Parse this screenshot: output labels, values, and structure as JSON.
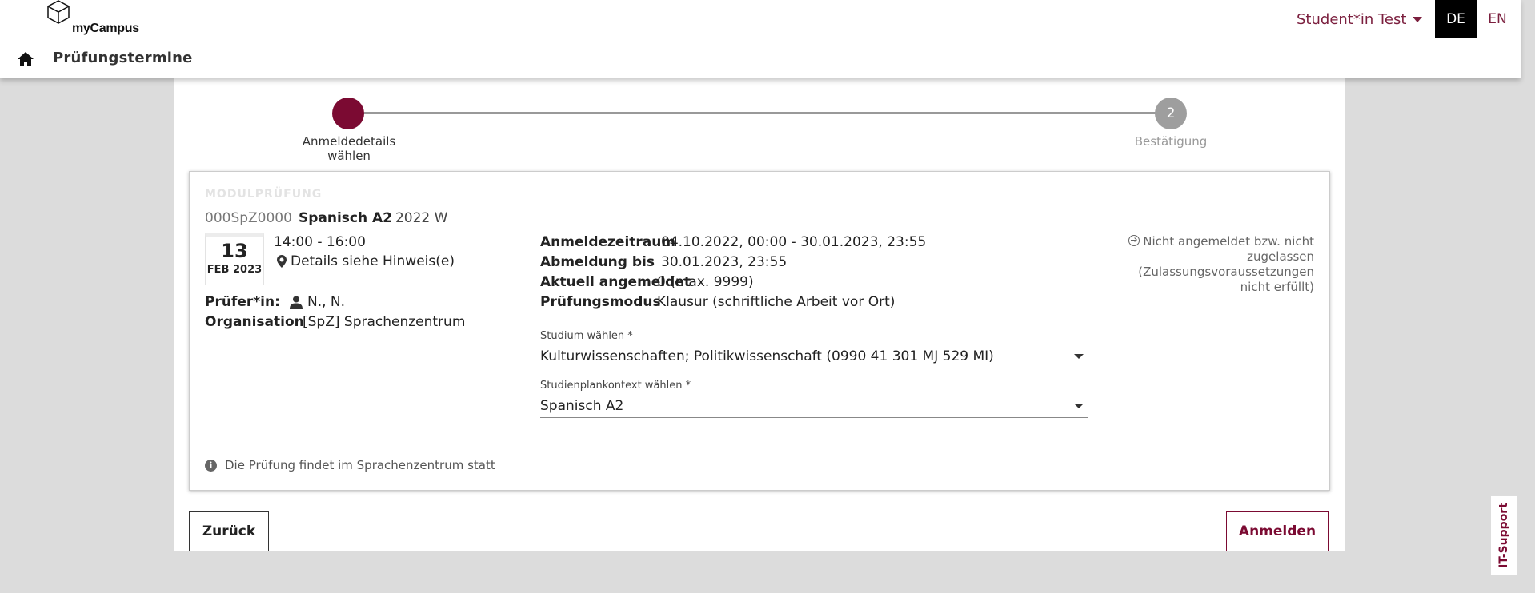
{
  "header": {
    "logo_text": "myCampus",
    "page_title": "Prüfungstermine",
    "user_menu": "Student*in Test",
    "lang_de": "DE",
    "lang_en": "EN"
  },
  "stepper": {
    "step1_label": "Anmeldedetails wählen",
    "step2_number": "2",
    "step2_label": "Bestätigung"
  },
  "exam": {
    "kicker": "MODULPRÜFUNG",
    "code": "000SpZ0000",
    "course": "Spanisch A2",
    "term": "2022 W",
    "date_day": "13",
    "date_month": "FEB 2023",
    "time": "14:00 - 16:00",
    "location": "Details siehe Hinweis(e)",
    "examiner_label": "Prüfer*in:",
    "examiner_value": "N., N.",
    "org_label": "Organisation",
    "org_value": "[SpZ] Sprachenzentrum"
  },
  "details": {
    "registration_period_label": "Anmeldezeitraum",
    "registration_period_value": "04.10.2022, 00:00 - 30.01.2023, 23:55",
    "deregistration_label": "Abmeldung bis",
    "deregistration_value": "30.01.2023, 23:55",
    "registered_label": "Aktuell angemeldet",
    "registered_value": "0 (max. 9999)",
    "mode_label": "Prüfungsmodus",
    "mode_value": "Klausur (schriftliche Arbeit vor Ort)"
  },
  "form": {
    "study_label": "Studium wählen *",
    "study_value": "Kulturwissenschaften; Politikwissenschaft (0990 41 301 MJ 529 MI)",
    "context_label": "Studienplankontext wählen *",
    "context_value": "Spanisch A2"
  },
  "status_text": "Nicht angemeldet bzw. nicht zugelassen (Zulassungsvoraussetzungen nicht erfüllt)",
  "note": "Die Prüfung findet im Sprachenzentrum statt",
  "buttons": {
    "back": "Zurück",
    "register": "Anmelden"
  },
  "it_support": "IT-Support",
  "colors": {
    "accent": "#7b0a32",
    "header_link": "#7b1f3e"
  }
}
